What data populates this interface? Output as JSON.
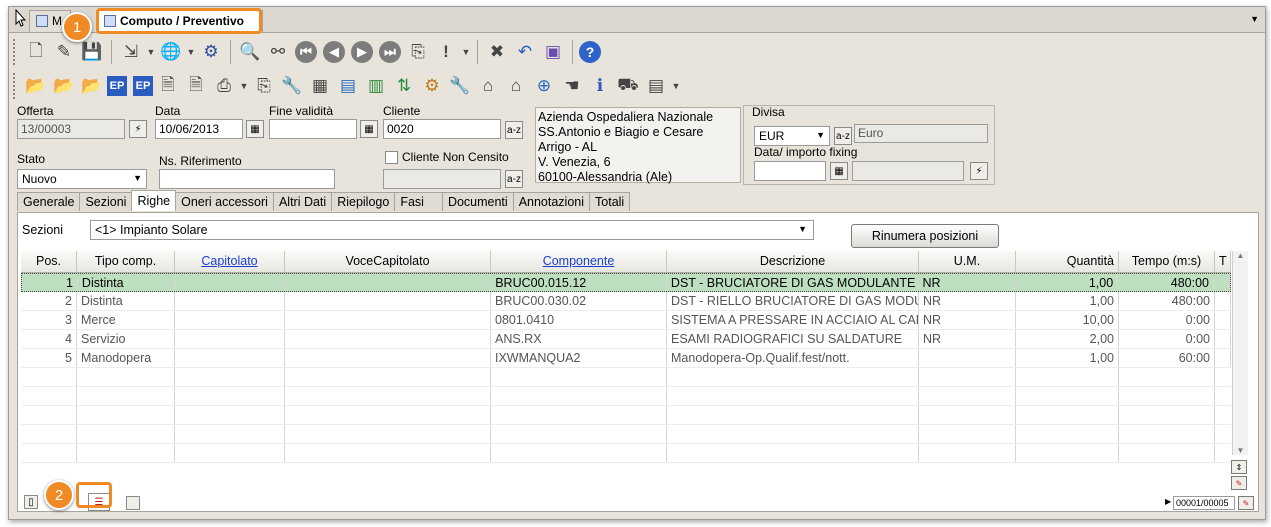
{
  "tabs": {
    "first_label": "M",
    "active_label": "Computo / Preventivo"
  },
  "toolbar": {
    "row1_icons": [
      "new-document-icon",
      "edit-icon",
      "save-icon",
      "export-icon",
      "globe-icon",
      "settings-icon",
      "find-icon",
      "binoculars-icon",
      "first-record-icon",
      "previous-record-icon",
      "next-record-icon",
      "last-record-icon",
      "copy-icon",
      "alert-icon",
      "delete-icon",
      "undo-icon",
      "print-setup-icon",
      "help-icon"
    ],
    "row2_icons": [
      "open-folder-icon",
      "open-folder-2-icon",
      "open-folder-3-icon",
      "ep-icon",
      "ep-doc-icon",
      "doc-edit-icon",
      "doc-move-icon",
      "print-icon",
      "copy-icon",
      "tools-icon",
      "calculator-icon",
      "spreadsheet-icon",
      "sort-icon",
      "gears-icon",
      "wrench-icon",
      "home-icon",
      "home-2-icon",
      "compass-icon",
      "hand-icon",
      "info-icon",
      "tag-icon",
      "list-icon"
    ]
  },
  "form": {
    "offerta_label": "Offerta",
    "offerta_value": "13/00003",
    "data_label": "Data",
    "data_value": "10/06/2013",
    "fine_validita_label": "Fine validità",
    "fine_validita_value": "",
    "cliente_label": "Cliente",
    "cliente_value": "0020",
    "cliente_non_censito_label": "Cliente Non Censito",
    "stato_label": "Stato",
    "stato_value": "Nuovo",
    "ns_riferimento_label": "Ns. Riferimento",
    "ns_riferimento_value": "",
    "address_lines": [
      "Azienda Ospedaliera Nazionale",
      "SS.Antonio e Biagio e Cesare",
      "Arrigo - AL",
      "V. Venezia, 6",
      "60100-Alessandria (Ale)"
    ],
    "divisa_label": "Divisa",
    "divisa_code": "EUR",
    "divisa_name": "Euro",
    "fixing_label": "Data/ importo fixing"
  },
  "subtabs": [
    "Generale",
    "Sezioni",
    "Righe",
    "Oneri accessori",
    "Altri Dati",
    "Riepilogo",
    "Fasi",
    "Documenti",
    "Annotazioni",
    "Totali"
  ],
  "righe": {
    "sezioni_label": "Sezioni",
    "sezioni_value": "<1> Impianto Solare",
    "rinumera_label": "Rinumera posizioni",
    "columns": [
      "Pos.",
      "Tipo comp.",
      "Capitolato",
      "VoceCapitolato",
      "Componente",
      "Descrizione",
      "U.M.",
      "Quantità",
      "Tempo (m:s)",
      "T"
    ],
    "rows": [
      {
        "pos": "1",
        "tipo": "Distinta",
        "cap": "",
        "voce": "",
        "comp": "BRUC00.015.12",
        "desc": "DST - BRUCIATORE DI GAS MODULANTE",
        "um": "NR",
        "qta": "1,00",
        "tempo": "480:00"
      },
      {
        "pos": "2",
        "tipo": "Distinta",
        "cap": "",
        "voce": "",
        "comp": "BRUC00.030.02",
        "desc": "DST - RIELLO BRUCIATORE DI GAS MODULANTE",
        "um": "NR",
        "qta": "1,00",
        "tempo": "480:00"
      },
      {
        "pos": "3",
        "tipo": "Merce",
        "cap": "",
        "voce": "",
        "comp": "0801.0410",
        "desc": "SISTEMA A PRESSARE IN ACCIAIO AL CARBONIO",
        "um": "NR",
        "qta": "10,00",
        "tempo": "0:00"
      },
      {
        "pos": "4",
        "tipo": "Servizio",
        "cap": "",
        "voce": "",
        "comp": "ANS.RX",
        "desc": "ESAMI RADIOGRAFICI SU SALDATURE",
        "um": "NR",
        "qta": "2,00",
        "tempo": "0:00"
      },
      {
        "pos": "5",
        "tipo": "Manodopera",
        "cap": "",
        "voce": "",
        "comp": "IXWMANQUA2",
        "desc": "Manodopera-Op.Qualif.fest/nott.",
        "um": "",
        "qta": "1,00",
        "tempo": "60:00"
      }
    ],
    "record_counter": "00001/00005"
  },
  "callouts": {
    "one": "1",
    "two": "2"
  },
  "colors": {
    "accent": "#f08a24",
    "selected_row": "#bfe0c0",
    "link": "#1a3fd0"
  }
}
